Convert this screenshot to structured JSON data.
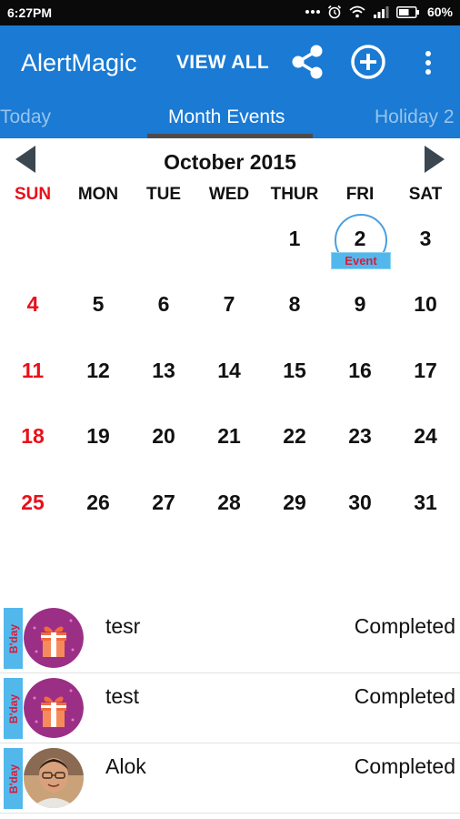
{
  "status_bar": {
    "time": "6:27PM",
    "battery": "60%"
  },
  "app_bar": {
    "title": "AlertMagic",
    "view_all_label": "VIEW ALL",
    "icons": [
      "share-icon",
      "add-circle-icon",
      "more-vert-icon"
    ],
    "accent_color": "#1a7ad4"
  },
  "tabs": [
    {
      "label": "Today"
    },
    {
      "label": "Month Events",
      "active": true
    },
    {
      "label": "Holiday 2"
    }
  ],
  "calendar": {
    "month_title": "October 2015",
    "weekdays": [
      "SUN",
      "MON",
      "TUE",
      "WED",
      "THUR",
      "FRI",
      "SAT"
    ],
    "days": [
      "1",
      "2",
      "3",
      "4",
      "5",
      "6",
      "7",
      "8",
      "9",
      "10",
      "11",
      "12",
      "13",
      "14",
      "15",
      "16",
      "17",
      "18",
      "19",
      "20",
      "21",
      "22",
      "23",
      "24",
      "25",
      "26",
      "27",
      "28",
      "29",
      "30",
      "31"
    ],
    "event_day": "2",
    "event_label": "Event",
    "sunday_color": "#e8101a"
  },
  "events": [
    {
      "tag": "B'day",
      "name": "tesr",
      "status": "Completed",
      "avatar": "gift-avatar-icon"
    },
    {
      "tag": "B'day",
      "name": "test",
      "status": "Completed",
      "avatar": "gift-avatar-icon"
    },
    {
      "tag": "B'day",
      "name": "Alok",
      "status": "Completed",
      "avatar": "person-photo-avatar"
    }
  ]
}
